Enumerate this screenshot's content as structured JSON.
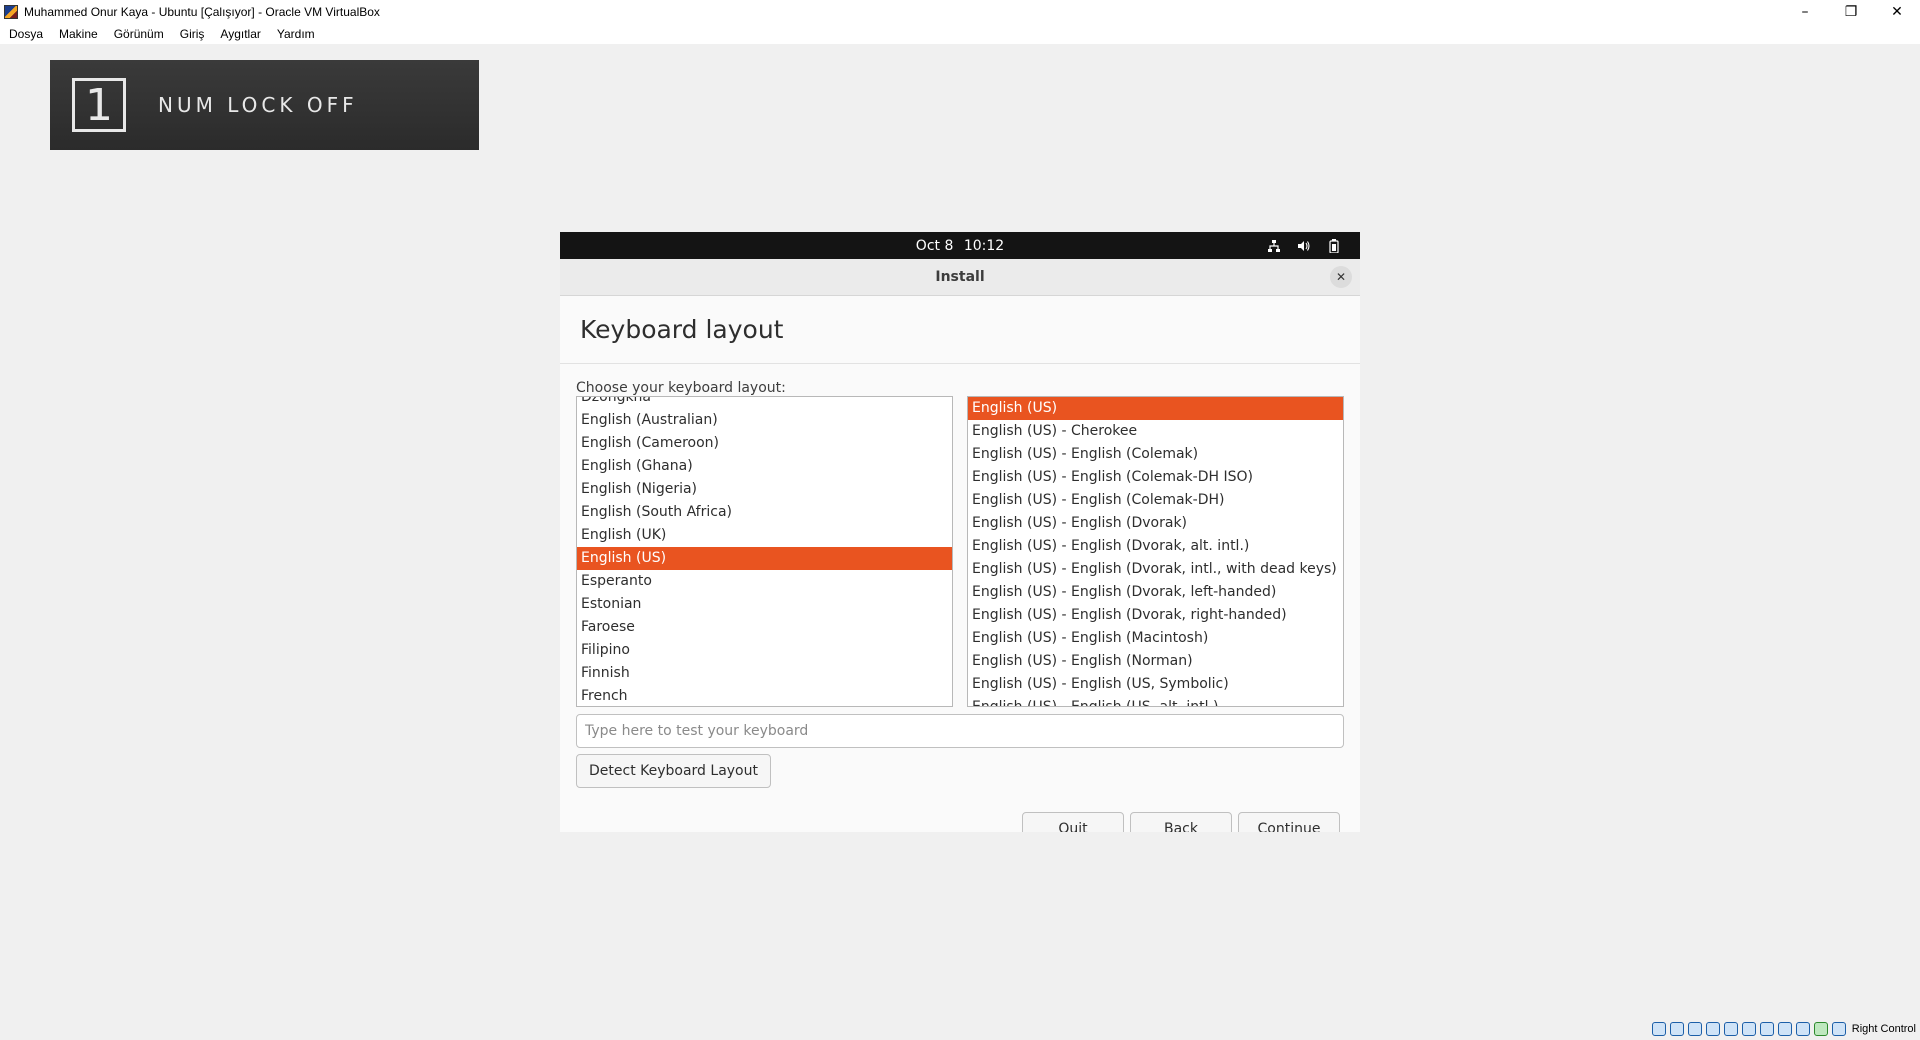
{
  "host": {
    "window_title": "Muhammed Onur Kaya - Ubuntu [Çalışıyor] - Oracle VM VirtualBox",
    "controls": {
      "minimize": "–",
      "restore": "❐",
      "close": "✕"
    },
    "menu": [
      "Dosya",
      "Makine",
      "Görünüm",
      "Giriş",
      "Aygıtlar",
      "Yardım"
    ],
    "status_host_key": "Right Control"
  },
  "overlay": {
    "digit": "1",
    "text": "NUM LOCK OFF"
  },
  "guest": {
    "clock": {
      "date": "Oct 8",
      "time": "10:12"
    },
    "tray": {
      "network": "⧉",
      "volume": "🔈",
      "battery": "▮"
    },
    "window_title": "Install",
    "close_symbol": "✕",
    "page_title": "Keyboard layout",
    "choose_label": "Choose your keyboard layout:",
    "layouts": [
      "Dzongkha",
      "English (Australian)",
      "English (Cameroon)",
      "English (Ghana)",
      "English (Nigeria)",
      "English (South Africa)",
      "English (UK)",
      "English (US)",
      "Esperanto",
      "Estonian",
      "Faroese",
      "Filipino",
      "Finnish",
      "French"
    ],
    "selected_layout": "English (US)",
    "variants": [
      "English (US)",
      "English (US) - Cherokee",
      "English (US) - English (Colemak)",
      "English (US) - English (Colemak-DH ISO)",
      "English (US) - English (Colemak-DH)",
      "English (US) - English (Dvorak)",
      "English (US) - English (Dvorak, alt. intl.)",
      "English (US) - English (Dvorak, intl., with dead keys)",
      "English (US) - English (Dvorak, left-handed)",
      "English (US) - English (Dvorak, right-handed)",
      "English (US) - English (Macintosh)",
      "English (US) - English (Norman)",
      "English (US) - English (US, Symbolic)",
      "English (US) - English (US, alt. intl.)"
    ],
    "selected_variant": "English (US)",
    "test_placeholder": "Type here to test your keyboard",
    "detect_button": "Detect Keyboard Layout",
    "quit_button": "Quit",
    "back_button": "Back",
    "continue_button": "Continue"
  },
  "colors": {
    "accent": "#e95420",
    "topbar": "#141414"
  }
}
